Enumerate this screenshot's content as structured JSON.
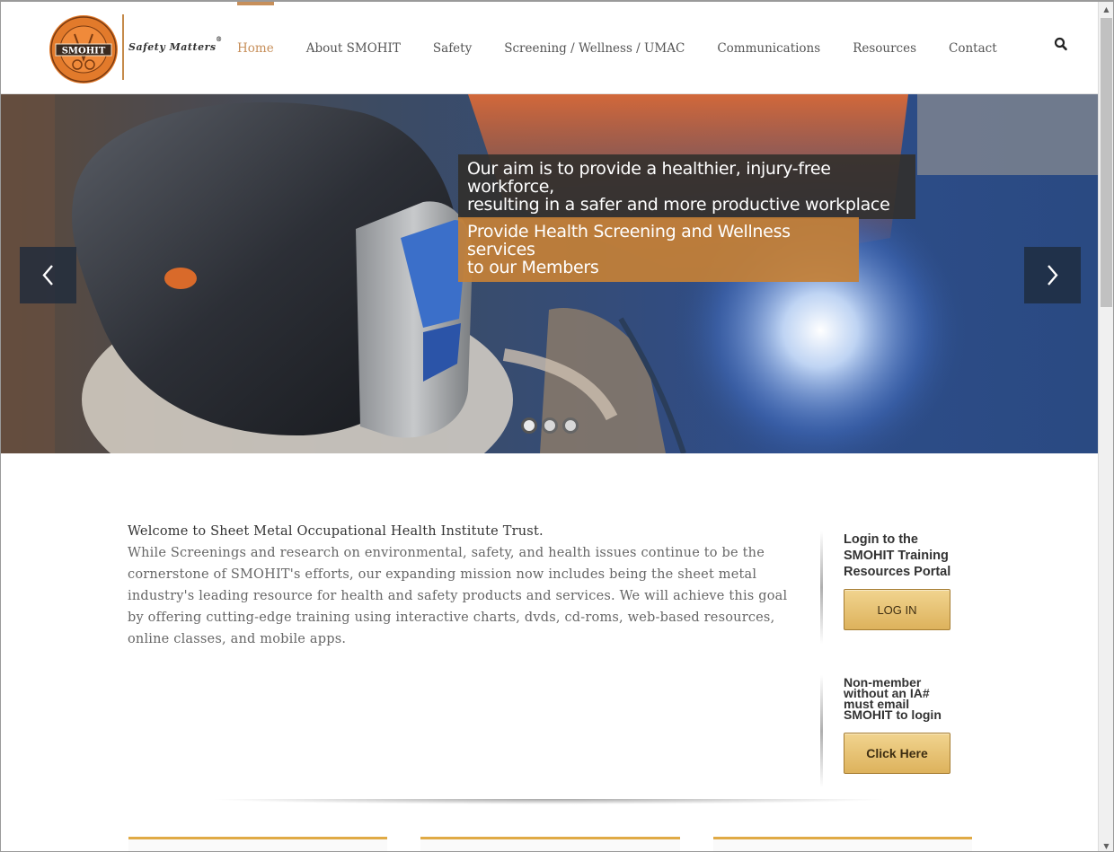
{
  "header": {
    "logo_text": "SMOHIT",
    "logo_ring_text": "SHEET METAL OCCUPATIONAL HEALTH INSTITUTE TRUST",
    "tagline": "Safety Matters",
    "tagline_mark": "®"
  },
  "nav": {
    "items": [
      {
        "label": "Home",
        "active": true
      },
      {
        "label": "About SMOHIT",
        "active": false
      },
      {
        "label": "Safety",
        "active": false
      },
      {
        "label": "Screening / Wellness / UMAC",
        "active": false
      },
      {
        "label": "Communications",
        "active": false
      },
      {
        "label": "Resources",
        "active": false
      },
      {
        "label": "Contact",
        "active": false
      }
    ],
    "search_icon": "search-icon"
  },
  "hero": {
    "caption_primary": "Our aim is to provide a healthier, injury-free workforce, resulting in a safer and more productive workplace",
    "caption_primary_line1": "Our aim is to provide a healthier, injury-free workforce,",
    "caption_primary_line2": "resulting in a safer and more productive workplace",
    "caption_secondary_line1": "Provide Health Screening and Wellness services",
    "caption_secondary_line2": "to our Members",
    "prev_icon": "chevron-left-icon",
    "next_icon": "chevron-right-icon",
    "slide_count": 3,
    "active_slide": 1
  },
  "welcome": {
    "title": "Welcome to Sheet Metal Occupational Health Institute Trust.",
    "body": "While Screenings and research on environmental, safety, and health issues continue to be the cornerstone of SMOHIT's efforts, our expanding mission now includes being the sheet metal industry's leading resource for health and safety products and services. We will achieve this goal by offering cutting-edge training using interactive charts, dvds, cd-roms, web-based resources, online classes, and mobile apps."
  },
  "sidebar": {
    "login_heading": "Login to the SMOHIT Training Resources Portal",
    "login_button": "LOG IN",
    "nonmember_heading": "Non-member without an IA# must email SMOHIT to login",
    "click_button": "Click Here"
  },
  "colors": {
    "accent": "#c78f5a",
    "caption_orange": "#c48037",
    "button_gold": "#e6c273",
    "card_top": "#e0aa45"
  }
}
